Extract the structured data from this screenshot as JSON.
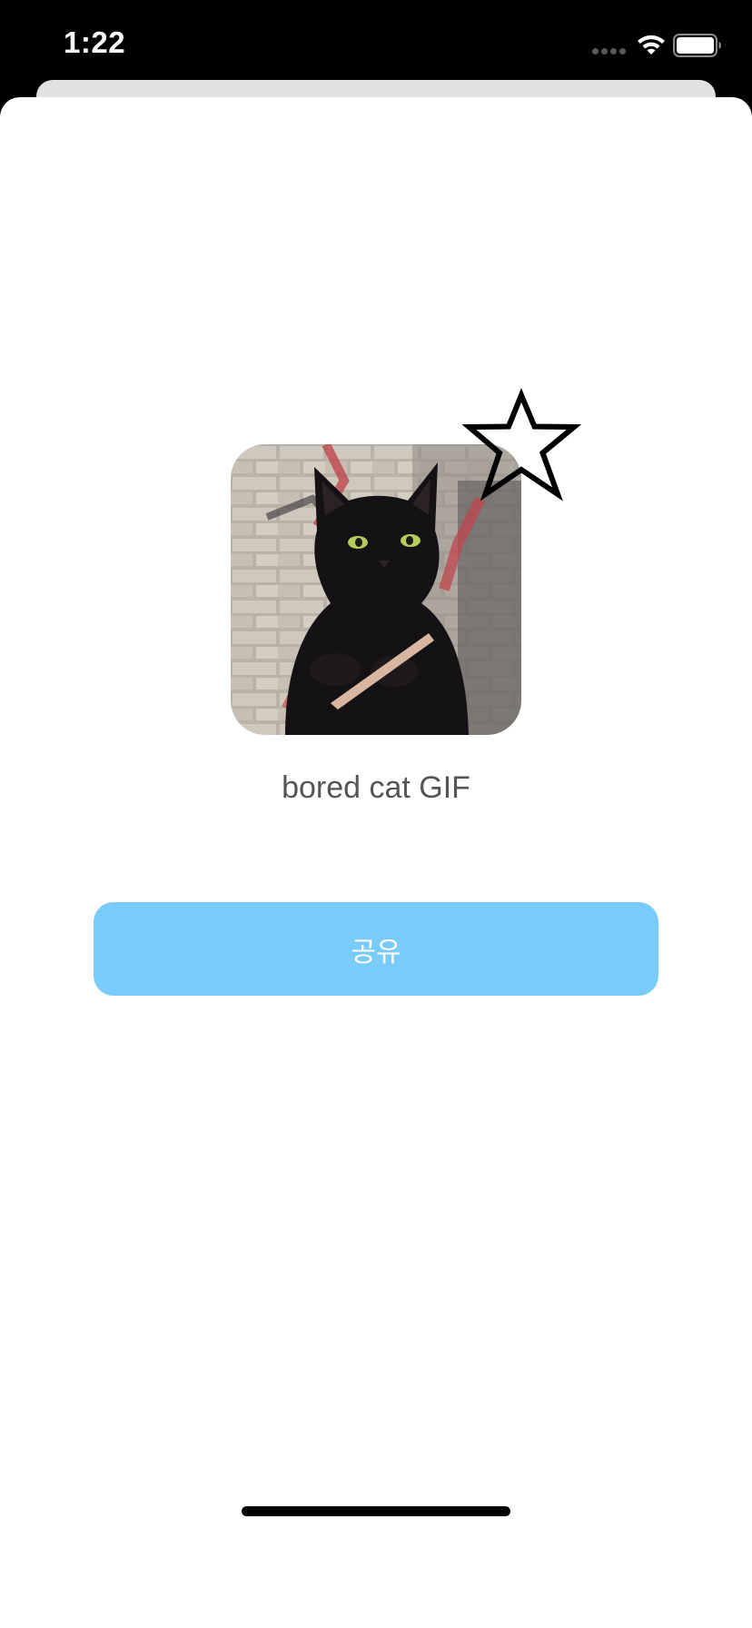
{
  "status_bar": {
    "time": "1:22",
    "icons": [
      "signal-dots-icon",
      "wifi-icon",
      "battery-icon"
    ]
  },
  "gif": {
    "title": "bored cat GIF",
    "image": "black-cat-nail-file-image",
    "favorite_icon": "star-outline-icon",
    "favorited": false
  },
  "actions": {
    "share_label": "공유"
  },
  "colors": {
    "share_button": "#79cbf9",
    "share_text": "#ffffff",
    "title_text": "#555555",
    "status_bar_bg": "#000000"
  }
}
